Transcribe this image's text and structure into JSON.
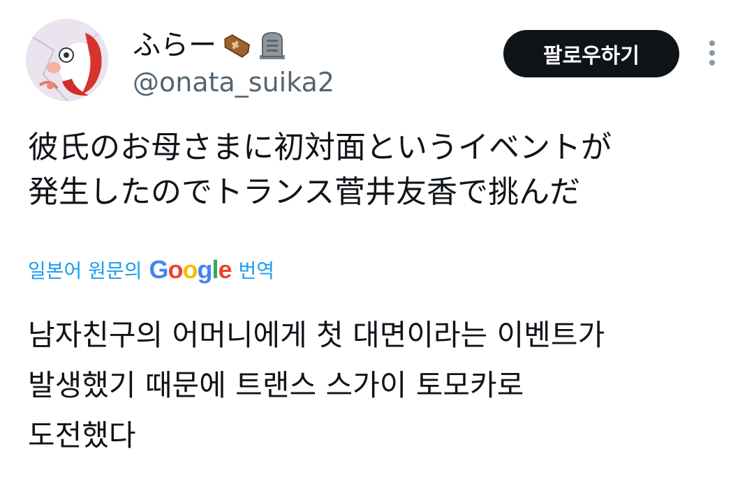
{
  "author": {
    "display_name": "ふらー",
    "emoji_icons": [
      "coffin-icon",
      "headstone-icon"
    ],
    "handle": "@onata_suika2"
  },
  "actions": {
    "follow_label": "팔로우하기",
    "more_icon": "more-vertical-icon"
  },
  "tweet": {
    "text": "彼氏のお母さまに初対面というイベントが\n発生したのでトランス菅井友香で挑んだ"
  },
  "translation": {
    "prefix": "일본어 원문의",
    "provider_logo": "Google",
    "suffix": "번역",
    "text": "남자친구의 어머니에게 첫 대면이라는 이벤트가\n발생했기 때문에 트랜스 스가이 토모카로\n도전했다"
  },
  "colors": {
    "text": "#0f1419",
    "secondary": "#536471",
    "link": "#1d9bf0",
    "button_bg": "#0f1419"
  }
}
